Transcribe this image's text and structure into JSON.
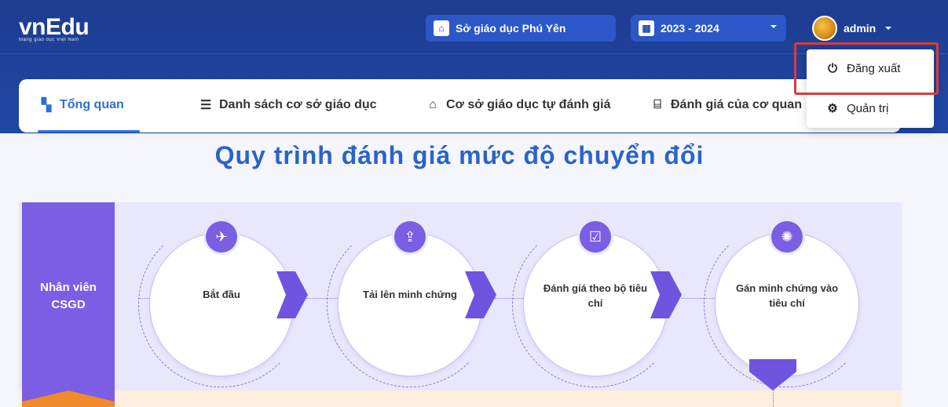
{
  "header": {
    "logo_text": "vnEdu",
    "logo_tagline": "Mạng giáo dục Việt Nam",
    "department": "Sở giáo dục Phú Yên",
    "school_year": "2023 - 2024",
    "username": "admin"
  },
  "nav": {
    "tabs": [
      {
        "label": "Tổng quan",
        "icon": "dashboard-icon",
        "active": true
      },
      {
        "label": "Danh sách cơ sở giáo dục",
        "icon": "list-icon",
        "active": false
      },
      {
        "label": "Cơ sở giáo dục tự đánh giá",
        "icon": "school-icon",
        "active": false
      },
      {
        "label": "Đánh giá của cơ quan",
        "icon": "institution-icon",
        "active": false
      }
    ]
  },
  "user_menu": {
    "items": [
      {
        "label": "Đăng xuất",
        "icon": "power-icon"
      },
      {
        "label": "Quản trị",
        "icon": "gear-icon"
      }
    ]
  },
  "main": {
    "title": "Quy trình đánh giá mức độ chuyển đổi",
    "role": "Nhân viên CSGD",
    "steps": [
      {
        "label": "Bắt đầu",
        "icon": "rocket-icon"
      },
      {
        "label": "Tải lên minh chứng",
        "icon": "upload-clipboard-icon"
      },
      {
        "label": "Đánh giá theo bộ tiêu chí",
        "icon": "checklist-icon"
      },
      {
        "label": "Gán minh chứng vào tiêu chí",
        "icon": "network-icon"
      }
    ]
  },
  "colors": {
    "header_bg": "#1f48a6",
    "accent_blue": "#2f6fd8",
    "purple": "#7a5ee3",
    "highlight_red": "#d93b3b"
  }
}
